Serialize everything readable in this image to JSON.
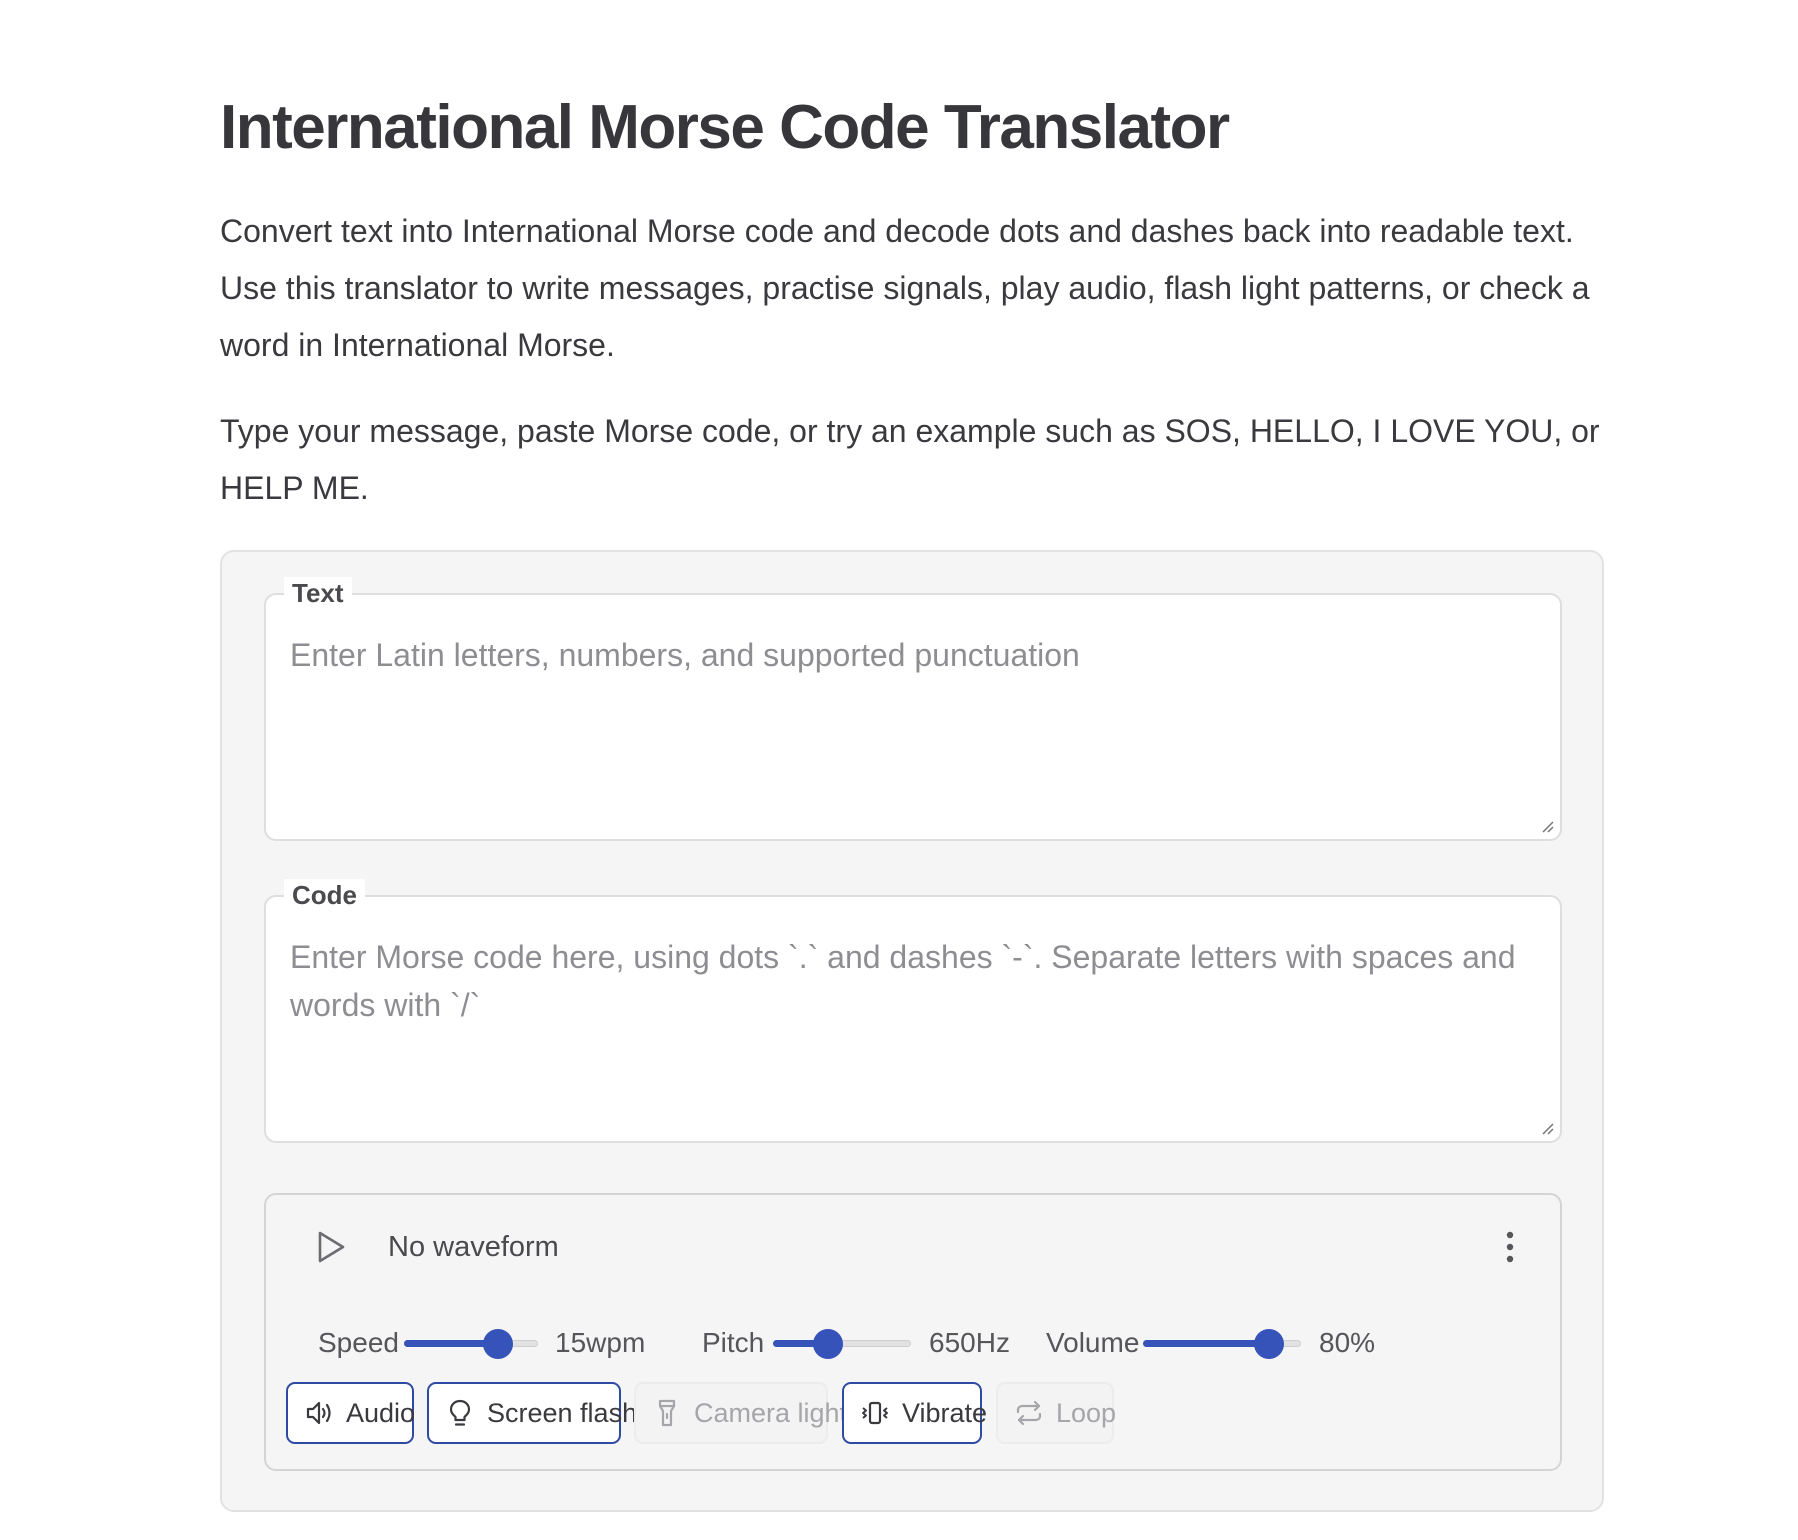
{
  "page": {
    "title": "International Morse Code Translator",
    "intro_1": "Convert text into International Morse code and decode dots and dashes back into readable text. Use this translator to write messages, practise signals, play audio, flash light patterns, or check a word in International Morse.",
    "intro_2": "Type your message, paste Morse code, or try an example such as SOS, HELLO, I LOVE YOU, or HELP ME."
  },
  "text_field": {
    "legend": "Text",
    "value": "",
    "placeholder": "Enter Latin letters, numbers, and supported punctuation"
  },
  "code_field": {
    "legend": "Code",
    "value": "",
    "placeholder": "Enter Morse code here, using dots `.` and dashes `-`. Separate letters with spaces and words with `/`"
  },
  "player": {
    "play_icon": "play-icon",
    "waveform_label": "No waveform",
    "menu_icon": "more-vertical-icon",
    "accent_color": "#3553b8",
    "controls": {
      "speed": {
        "label": "Speed",
        "value": "15wpm",
        "fraction": 0.7
      },
      "pitch": {
        "label": "Pitch",
        "value": "650Hz",
        "fraction": 0.4
      },
      "volume": {
        "label": "Volume",
        "value": "80%",
        "fraction": 0.8
      }
    },
    "buttons": [
      {
        "label": "Audio",
        "icon": "speaker-icon",
        "active": true
      },
      {
        "label": "Screen flash",
        "icon": "lightbulb-icon",
        "active": true
      },
      {
        "label": "Camera light",
        "icon": "flashlight-icon",
        "active": false
      },
      {
        "label": "Vibrate",
        "icon": "vibrate-icon",
        "active": true
      },
      {
        "label": "Loop",
        "icon": "repeat-icon",
        "active": false
      }
    ]
  }
}
